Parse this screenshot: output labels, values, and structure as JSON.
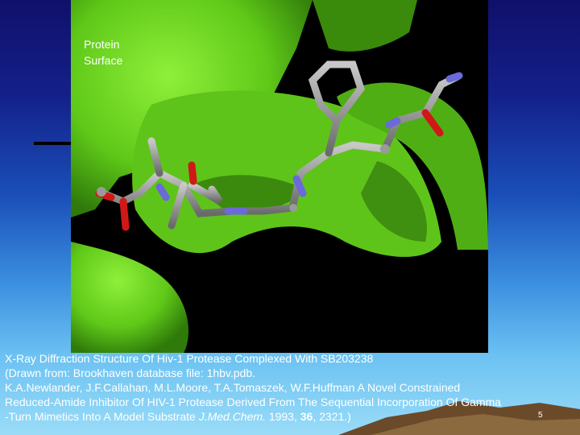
{
  "image": {
    "label": "Protein\nSurface"
  },
  "caption": {
    "line1": "X-Ray Diffraction Structure Of Hiv-1 Protease Complexed With SB203238",
    "line2": "(Drawn from:  Brookhaven database file: 1hbv.pdb.",
    "line3": "K.A.Newlander,  J.F.Callahan, M.L.Moore, T.A.Tomaszek, W.F.Huffman A Novel Constrained",
    "line4": "Reduced-Amide Inhibitor Of HIV-1 Protease Derived From The Sequential Incorporation Of Gamma",
    "line5_pre": "-Turn Mimetics Into A Model Substrate ",
    "line5_journal": "J.Med.Chem.",
    "line5_year": " 1993, ",
    "line5_volume": "36",
    "line5_pages": ", 2321.)"
  },
  "slide_number": "5",
  "colors": {
    "surface_green": "#6fd81a",
    "carbon_gray": "#8c8c8c",
    "nitrogen_blue": "#6a6ad8",
    "oxygen_red": "#d01818",
    "panel_black": "#000000"
  }
}
